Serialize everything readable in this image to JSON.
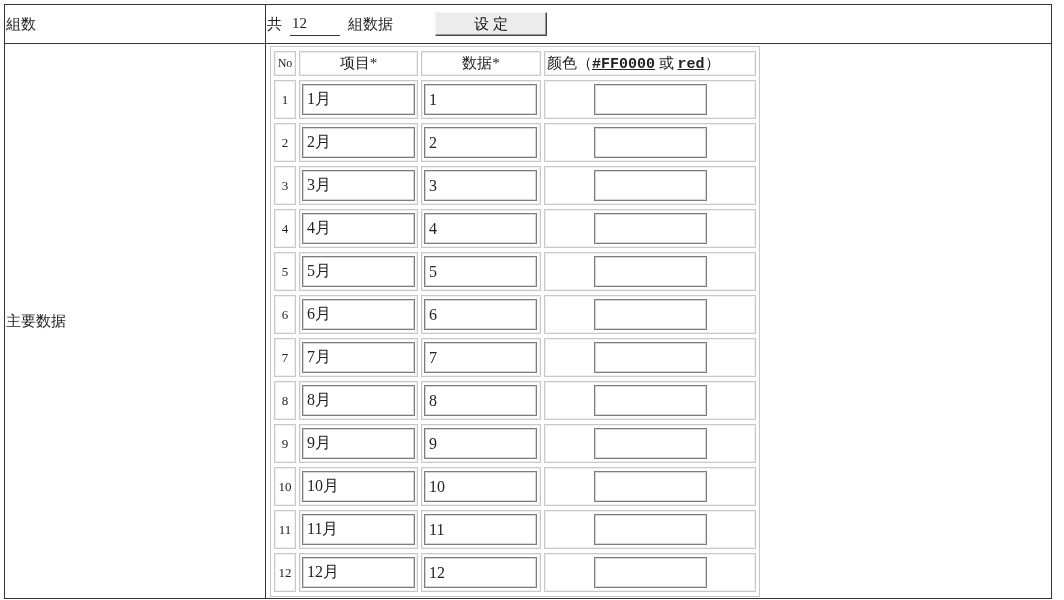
{
  "form": {
    "group_count": {
      "label": "組数",
      "prefix": "共",
      "count_field": {
        "value": "12"
      },
      "suffix": "組数据",
      "set_button": "设 定"
    },
    "main_data": {
      "label": "主要数据",
      "table": {
        "columns": [
          "No",
          "项目*",
          "数据*",
          "颜色（**#FF0000** 或 **red**）"
        ],
        "rows": [
          {
            "no": "1",
            "item": "1月",
            "data": "1"
          },
          {
            "no": "2",
            "item": "2月",
            "data": "2"
          },
          {
            "no": "3",
            "item": "3月",
            "data": "3"
          },
          {
            "no": "4",
            "item": "4月",
            "data": "4"
          },
          {
            "no": "5",
            "item": "5月",
            "data": "5"
          },
          {
            "no": "6",
            "item": "6月",
            "data": "6"
          },
          {
            "no": "7",
            "item": "7月",
            "data": "7"
          },
          {
            "no": "8",
            "item": "8月",
            "data": "8"
          },
          {
            "no": "9",
            "item": "9月",
            "data": "9"
          },
          {
            "no": "10",
            "item": "10月",
            "data": "10"
          },
          {
            "no": "11",
            "item": "11月",
            "data": "11"
          },
          {
            "no": "12",
            "item": "12月",
            "data": "12"
          }
        ]
      }
    }
  }
}
